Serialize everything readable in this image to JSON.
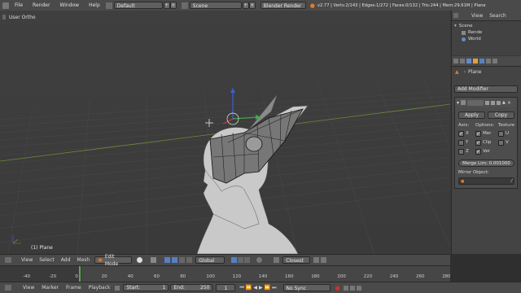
{
  "topbar": {
    "menus": [
      "File",
      "Render",
      "Window",
      "Help"
    ],
    "layout": "Default",
    "scene": "Scene",
    "engine": "Blender Render",
    "stats": "v2.77 | Verts:2/143 | Edges:1/272 | Faces:0/132 | Tris:244 | Mem:29.61M | Plane"
  },
  "viewport": {
    "label": "User Ortho",
    "object_label": "(1) Plane"
  },
  "outliner": {
    "view": "View",
    "search": "Search",
    "tree": [
      "Scene",
      "Rende",
      "World"
    ]
  },
  "properties": {
    "object": "Plane",
    "add_modifier": "Add Modifier",
    "apply": "Apply",
    "copy": "Copy",
    "axis_label": "Axis:",
    "options_label": "Options:",
    "texture_label": "Texture",
    "x": "X",
    "y": "Y",
    "z": "Z",
    "opt_merge": "Mer",
    "opt_clip": "Clip",
    "opt_vert": "Ver",
    "u": "U",
    "v": "V",
    "merge_limit": "Merge Lim: 0.001000",
    "mirror_object": "Mirror Object:"
  },
  "vheader": {
    "view": "View",
    "select": "Select",
    "add": "Add",
    "mesh": "Mesh",
    "mode": "Edit Mode",
    "orientation": "Global",
    "snap": "Closest"
  },
  "timeline": {
    "ticks": [
      "-40",
      "-20",
      "0",
      "20",
      "40",
      "60",
      "80",
      "100",
      "120",
      "140",
      "160",
      "180",
      "200",
      "220",
      "240",
      "260",
      "280"
    ],
    "current_frame": 0
  },
  "tlheader": {
    "view": "View",
    "marker": "Marker",
    "frame": "Frame",
    "playback": "Playback",
    "start": "Start:",
    "start_val": "1",
    "end": "End:",
    "end_val": "250",
    "current": "1",
    "sync": "No Sync"
  },
  "colors": {
    "accent": "#e07c2a",
    "selected_field": "#5680c2",
    "axis_x": "#c83b3b",
    "axis_y": "#3fa84a",
    "axis_z": "#3d5fd8"
  }
}
